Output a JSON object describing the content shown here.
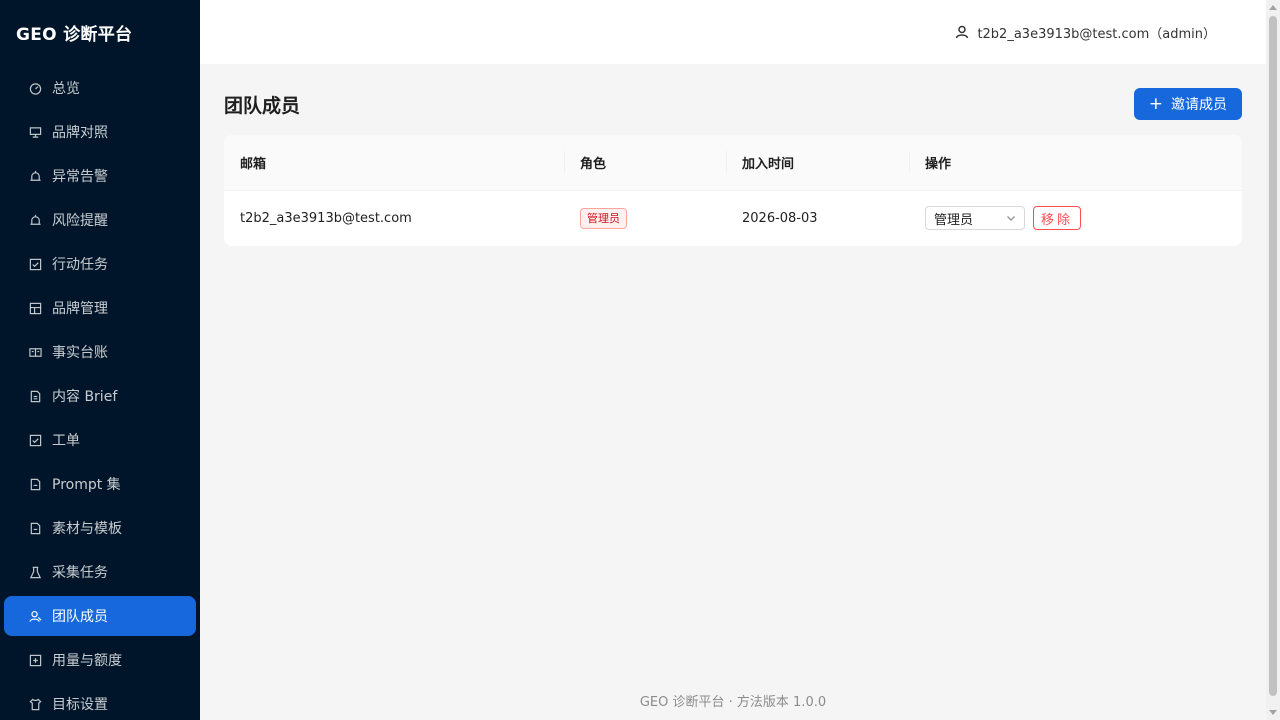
{
  "app": {
    "title": "GEO 诊断平台"
  },
  "sidebar": {
    "items": [
      {
        "label": "总览",
        "icon": "dashboard-icon"
      },
      {
        "label": "品牌对照",
        "icon": "compare-icon"
      },
      {
        "label": "异常告警",
        "icon": "alert-icon"
      },
      {
        "label": "风险提醒",
        "icon": "risk-icon"
      },
      {
        "label": "行动任务",
        "icon": "task-icon"
      },
      {
        "label": "品牌管理",
        "icon": "brand-icon"
      },
      {
        "label": "事实台账",
        "icon": "ledger-icon"
      },
      {
        "label": "内容 Brief",
        "icon": "brief-icon"
      },
      {
        "label": "工单",
        "icon": "ticket-icon"
      },
      {
        "label": "Prompt 集",
        "icon": "prompt-icon"
      },
      {
        "label": "素材与模板",
        "icon": "template-icon"
      },
      {
        "label": "采集任务",
        "icon": "crawl-icon"
      },
      {
        "label": "团队成员",
        "icon": "team-icon",
        "active": true
      },
      {
        "label": "用量与额度",
        "icon": "usage-icon"
      },
      {
        "label": "目标设置",
        "icon": "target-icon"
      }
    ]
  },
  "header": {
    "user": "t2b2_a3e3913b@test.com（admin）"
  },
  "main": {
    "title": "团队成员",
    "invite_label": "邀请成员",
    "table": {
      "columns": [
        "邮箱",
        "角色",
        "加入时间",
        "操作"
      ],
      "rows": [
        {
          "email": "t2b2_a3e3913b@test.com",
          "role": "管理员",
          "joined": "2026-08-03",
          "select_value": "管理员",
          "remove_label": "移除"
        }
      ]
    }
  },
  "footer": {
    "text": "GEO 诊断平台 · 方法版本 1.0.0"
  },
  "colors": {
    "sidebar_bg": "#001529",
    "accent": "#1668dc",
    "danger": "#ff4d4f"
  }
}
